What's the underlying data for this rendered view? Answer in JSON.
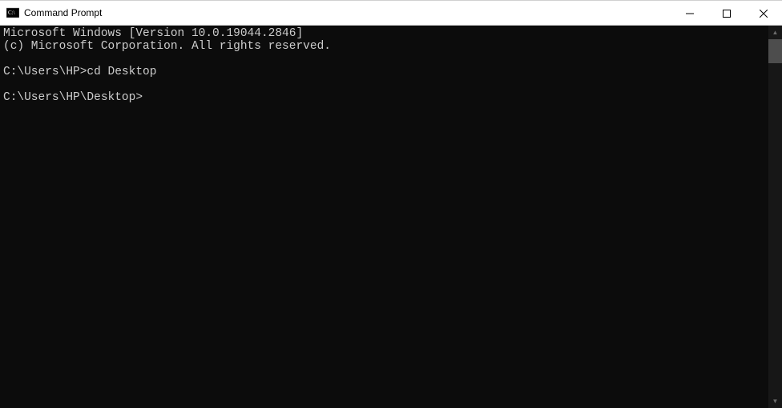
{
  "window": {
    "title": "Command Prompt"
  },
  "console": {
    "lines": [
      "Microsoft Windows [Version 10.0.19044.2846]",
      "(c) Microsoft Corporation. All rights reserved.",
      "",
      "C:\\Users\\HP>cd Desktop",
      "",
      "C:\\Users\\HP\\Desktop>"
    ]
  },
  "scrollbar": {
    "up_glyph": "▲",
    "down_glyph": "▼"
  }
}
